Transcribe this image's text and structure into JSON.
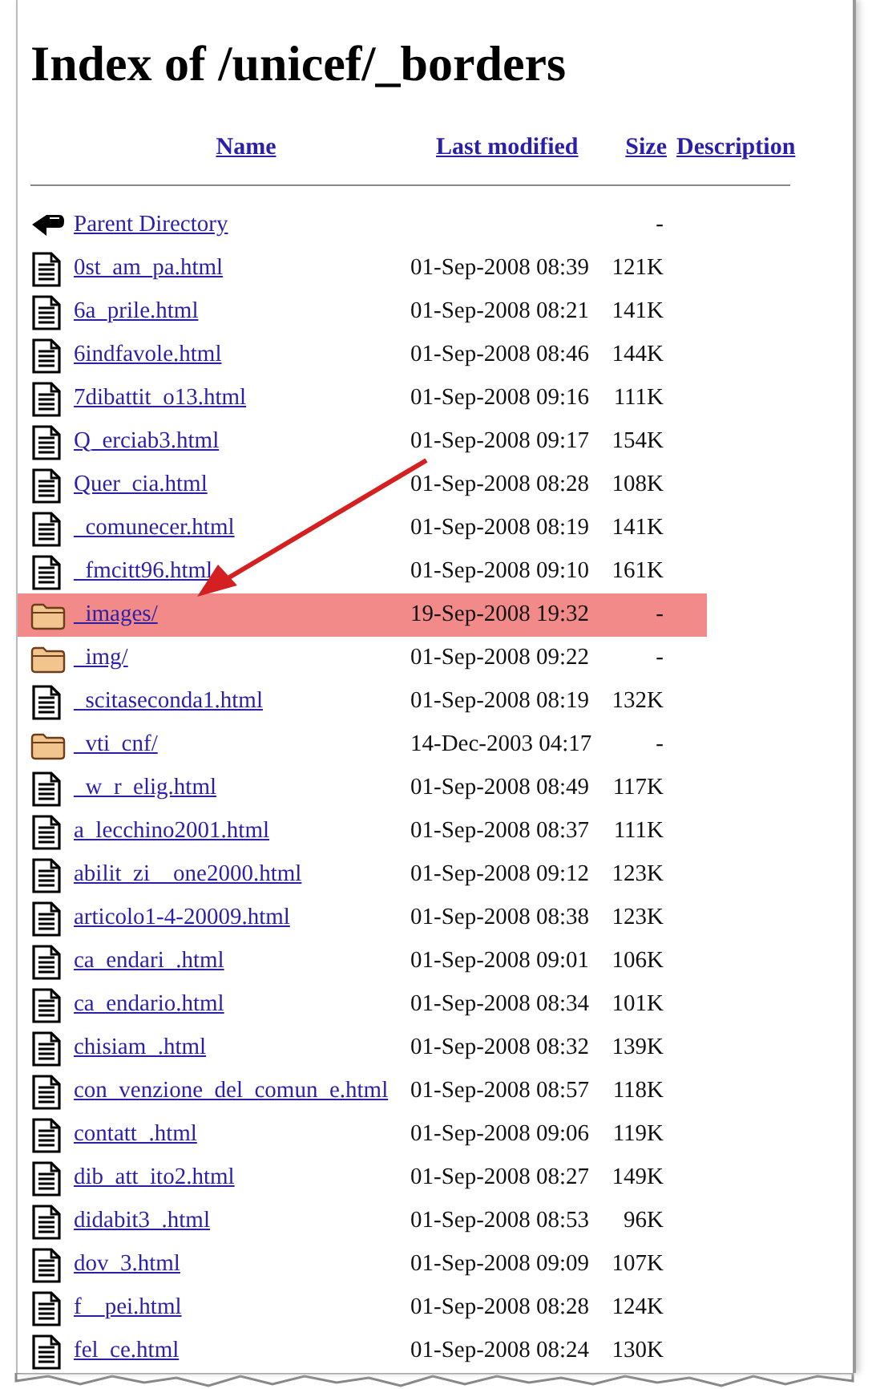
{
  "title": "Index of /unicef/_borders",
  "columns": [
    {
      "label": "Name"
    },
    {
      "label": "Last modified"
    },
    {
      "label": "Size"
    },
    {
      "label": "Description"
    }
  ],
  "rows": [
    {
      "kind": "parent",
      "name": "Parent Directory",
      "modified": "",
      "size": "-",
      "selected": false
    },
    {
      "kind": "file",
      "name": "0st_am_pa.html",
      "modified": "01-Sep-2008 08:39",
      "size": "121K",
      "selected": false
    },
    {
      "kind": "file",
      "name": "6a_prile.html",
      "modified": "01-Sep-2008 08:21",
      "size": "141K",
      "selected": false
    },
    {
      "kind": "file",
      "name": "6indfavole.html",
      "modified": "01-Sep-2008 08:46",
      "size": "144K",
      "selected": false
    },
    {
      "kind": "file",
      "name": "7dibattit_o13.html",
      "modified": "01-Sep-2008 09:16",
      "size": "111K",
      "selected": false
    },
    {
      "kind": "file",
      "name": "Q_erciab3.html",
      "modified": "01-Sep-2008 09:17",
      "size": "154K",
      "selected": false
    },
    {
      "kind": "file",
      "name": "Quer_cia.html",
      "modified": "01-Sep-2008 08:28",
      "size": "108K",
      "selected": false
    },
    {
      "kind": "file",
      "name": "_comunecer.html",
      "modified": "01-Sep-2008 08:19",
      "size": "141K",
      "selected": false
    },
    {
      "kind": "file",
      "name": "_fmcitt96.html",
      "modified": "01-Sep-2008 09:10",
      "size": "161K",
      "selected": false
    },
    {
      "kind": "folder",
      "name": "_images/",
      "modified": "19-Sep-2008 19:32",
      "size": "-",
      "selected": true
    },
    {
      "kind": "folder",
      "name": "_img/",
      "modified": "01-Sep-2008 09:22",
      "size": "-",
      "selected": false
    },
    {
      "kind": "file",
      "name": "_scitaseconda1.html",
      "modified": "01-Sep-2008 08:19",
      "size": "132K",
      "selected": false
    },
    {
      "kind": "folder",
      "name": "_vti_cnf/",
      "modified": "14-Dec-2003 04:17",
      "size": "-",
      "selected": false
    },
    {
      "kind": "file",
      "name": "_w_r_elig.html",
      "modified": "01-Sep-2008 08:49",
      "size": "117K",
      "selected": false
    },
    {
      "kind": "file",
      "name": "a_lecchino2001.html",
      "modified": "01-Sep-2008 08:37",
      "size": "111K",
      "selected": false
    },
    {
      "kind": "file",
      "name": "abilit_zi__one2000.html",
      "modified": "01-Sep-2008 09:12",
      "size": "123K",
      "selected": false
    },
    {
      "kind": "file",
      "name": "articolo1-4-20009.html",
      "modified": "01-Sep-2008 08:38",
      "size": "123K",
      "selected": false
    },
    {
      "kind": "file",
      "name": "ca_endari_.html",
      "modified": "01-Sep-2008 09:01",
      "size": "106K",
      "selected": false
    },
    {
      "kind": "file",
      "name": "ca_endario.html",
      "modified": "01-Sep-2008 08:34",
      "size": "101K",
      "selected": false
    },
    {
      "kind": "file",
      "name": "chisiam_.html",
      "modified": "01-Sep-2008 08:32",
      "size": "139K",
      "selected": false
    },
    {
      "kind": "file",
      "name": "con_venzione_del_comun_e.html",
      "modified": "01-Sep-2008 08:57",
      "size": "118K",
      "selected": false
    },
    {
      "kind": "file",
      "name": "contatt_.html",
      "modified": "01-Sep-2008 09:06",
      "size": "119K",
      "selected": false
    },
    {
      "kind": "file",
      "name": "dib_att_ito2.html",
      "modified": "01-Sep-2008 08:27",
      "size": "149K",
      "selected": false
    },
    {
      "kind": "file",
      "name": "didabit3_.html",
      "modified": "01-Sep-2008 08:53",
      "size": "96K",
      "selected": false
    },
    {
      "kind": "file",
      "name": "dov_3.html",
      "modified": "01-Sep-2008 09:09",
      "size": "107K",
      "selected": false
    },
    {
      "kind": "file",
      "name": "f__pei.html",
      "modified": "01-Sep-2008 08:28",
      "size": "124K",
      "selected": false
    },
    {
      "kind": "file",
      "name": "fel_ce.html",
      "modified": "01-Sep-2008 08:24",
      "size": "130K",
      "selected": false
    }
  ]
}
